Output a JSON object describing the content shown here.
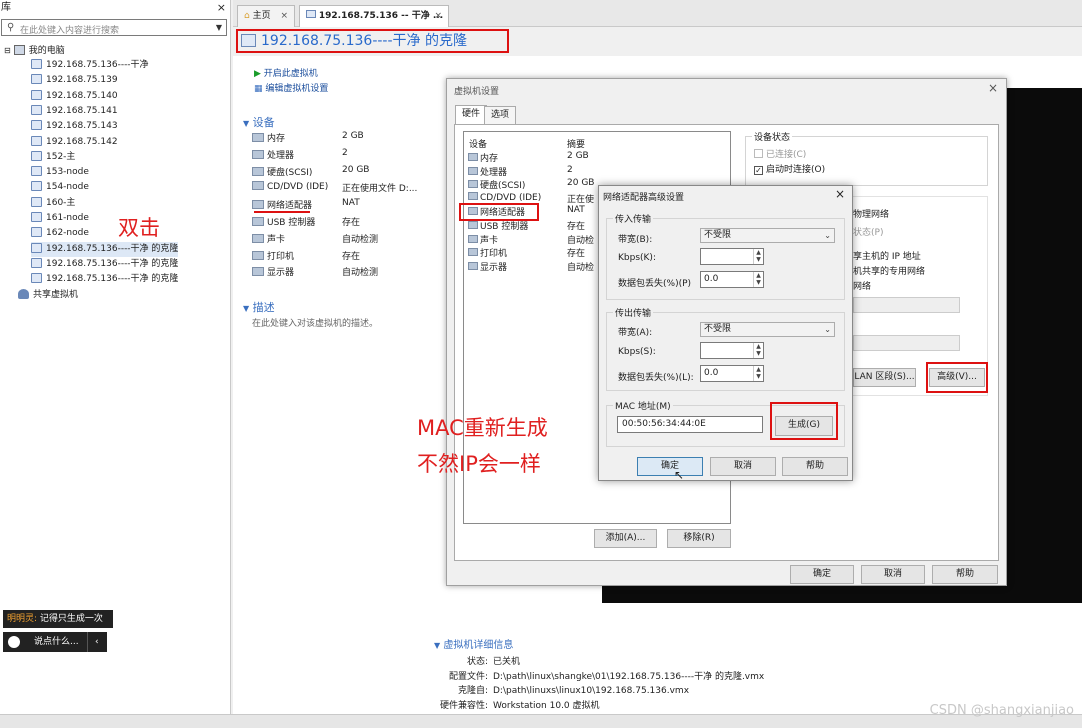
{
  "library": {
    "title": "库",
    "close": "×",
    "search_placeholder": "在此处键入内容进行搜索",
    "root_label": "我的电脑",
    "vms": [
      "192.168.75.136----干净",
      "192.168.75.139",
      "192.168.75.140",
      "192.168.75.141",
      "192.168.75.143",
      "192.168.75.142",
      "152-主",
      "153-node",
      "154-node",
      "160-主",
      "161-node",
      "162-node",
      "192.168.75.136----干净 的克隆",
      "192.168.75.136----干净 的克隆",
      "192.168.75.136----干净 的克隆"
    ],
    "shared_label": "共享虚拟机"
  },
  "bubbles": {
    "user": "明明灵:",
    "msg": "记得只生成一次",
    "say": "说点什么...",
    "arrow": "‹"
  },
  "tabs": [
    {
      "label": "主页",
      "close": "×"
    },
    {
      "label": "192.168.75.136 -- 干净 ...",
      "close": "×"
    }
  ],
  "vm_title": "192.168.75.136----干净 的克隆",
  "actions": {
    "power_on": "开启此虚拟机",
    "edit": "编辑虚拟机设置"
  },
  "devices_section": "设备",
  "devices": [
    {
      "name": "内存",
      "value": "2 GB"
    },
    {
      "name": "处理器",
      "value": "2"
    },
    {
      "name": "硬盘(SCSI)",
      "value": "20 GB"
    },
    {
      "name": "CD/DVD (IDE)",
      "value": "正在使用文件 D:..."
    },
    {
      "name": "网络适配器",
      "value": "NAT"
    },
    {
      "name": "USB 控制器",
      "value": "存在"
    },
    {
      "name": "声卡",
      "value": "自动检测"
    },
    {
      "name": "打印机",
      "value": "存在"
    },
    {
      "name": "显示器",
      "value": "自动检测"
    }
  ],
  "desc_section": "描述",
  "desc_placeholder": "在此处键入对该虚拟机的描述。",
  "annotations": {
    "double_click": "双击",
    "mac_line1": "MAC重新生成",
    "mac_line2": "不然IP会一样"
  },
  "settings_dialog": {
    "title": "虚拟机设置",
    "close": "×",
    "tab_hw": "硬件",
    "tab_opt": "选项",
    "col_device": "设备",
    "col_summary": "摘要",
    "rows": [
      {
        "name": "内存",
        "value": "2 GB"
      },
      {
        "name": "处理器",
        "value": "2"
      },
      {
        "name": "硬盘(SCSI)",
        "value": "20 GB"
      },
      {
        "name": "CD/DVD (IDE)",
        "value": "正在使"
      },
      {
        "name": "网络适配器",
        "value": "NAT"
      },
      {
        "name": "USB 控制器",
        "value": "存在"
      },
      {
        "name": "声卡",
        "value": "自动检"
      },
      {
        "name": "打印机",
        "value": "存在"
      },
      {
        "name": "显示器",
        "value": "自动检"
      }
    ],
    "status_group": "设备状态",
    "connected": "已连接(C)",
    "connect_on_start": "启动时连接(O)",
    "right_frag1": "物理网络",
    "right_frag2": "状态(P)",
    "right_frag3": "享主机的 IP 地址",
    "right_frag4": "机共享的专用网络",
    "right_frag5": "网络",
    "lan_btn": "LAN 区段(S)...",
    "adv_btn": "高级(V)...",
    "add_btn": "添加(A)...",
    "remove_btn": "移除(R)",
    "ok": "确定",
    "cancel": "取消",
    "help": "帮助"
  },
  "adapter_dialog": {
    "title": "网络适配器高级设置",
    "close": "×",
    "in_group": "传入传输",
    "out_group": "传出传输",
    "bw_in_label": "带宽(B):",
    "bw_in_value": "不受限",
    "kbps_in_label": "Kbps(K):",
    "kbps_in_value": "",
    "loss_in_label": "数据包丢失(%)(P)",
    "loss_in_value": "0.0",
    "bw_out_label": "带宽(A):",
    "bw_out_value": "不受限",
    "kbps_out_label": "Kbps(S):",
    "kbps_out_value": "",
    "loss_out_label": "数据包丢失(%)(L):",
    "loss_out_value": "0.0",
    "mac_label": "MAC 地址(M)",
    "mac_value": "00:50:56:34:44:0E",
    "generate": "生成(G)",
    "ok": "确定",
    "cancel": "取消",
    "help": "帮助"
  },
  "details": {
    "header": "虚拟机详细信息",
    "rows": [
      {
        "k": "状态:",
        "v": "已关机"
      },
      {
        "k": "配置文件:",
        "v": "D:\\path\\linux\\shangke\\01\\192.168.75.136----干净 的克隆.vmx"
      },
      {
        "k": "克隆自:",
        "v": "D:\\path\\linuxs\\linux10\\192.168.75.136.vmx"
      },
      {
        "k": "硬件兼容性:",
        "v": "Workstation 10.0 虚拟机"
      }
    ]
  },
  "watermark": "CSDN @shangxianjiao"
}
